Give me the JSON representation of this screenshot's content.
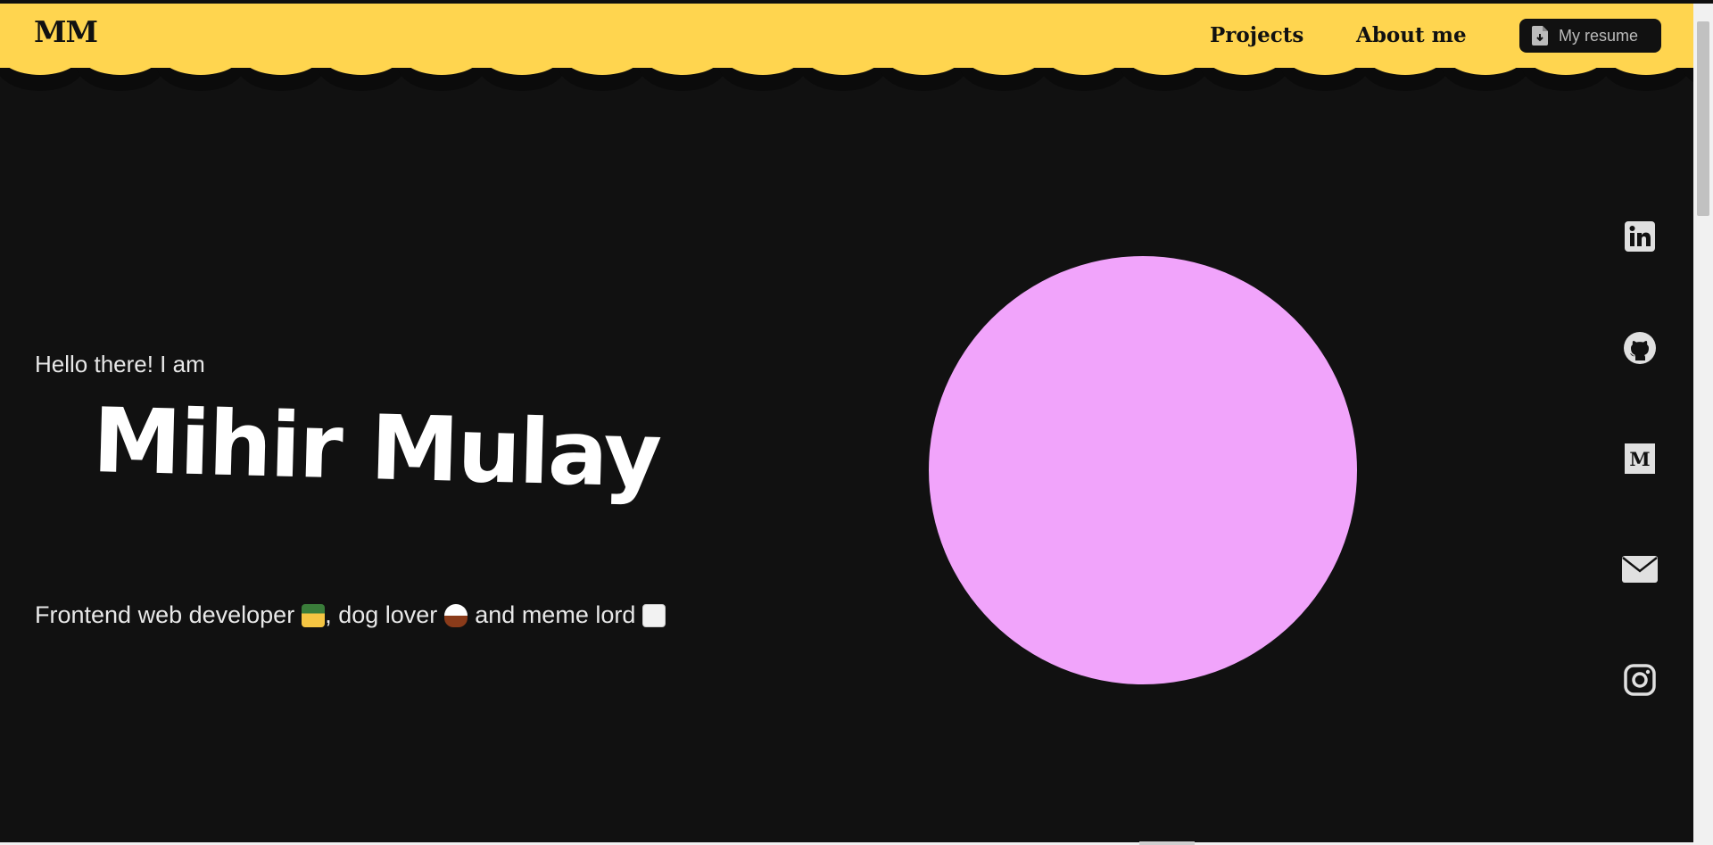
{
  "header": {
    "brand": "MM",
    "nav": {
      "projects": "Projects",
      "about": "About me"
    },
    "resume_label": "My resume",
    "background_color": "#ffd54f"
  },
  "hero": {
    "greeting": "Hello there! I am",
    "name": "Mihir Mulay",
    "tagline": {
      "part1": "Frontend web developer",
      "part2": ", dog lover",
      "part3": "and meme lord"
    },
    "emojis": [
      "technologist-emoji",
      "dog-face-emoji",
      "joker-card-emoji"
    ],
    "circle_color": "#f1a4fb"
  },
  "social": [
    "linkedin-icon",
    "github-icon",
    "medium-icon",
    "mail-icon",
    "instagram-icon"
  ],
  "colors": {
    "background": "#111111",
    "text": "#e8e8e8",
    "icon": "#e0e0e0"
  }
}
